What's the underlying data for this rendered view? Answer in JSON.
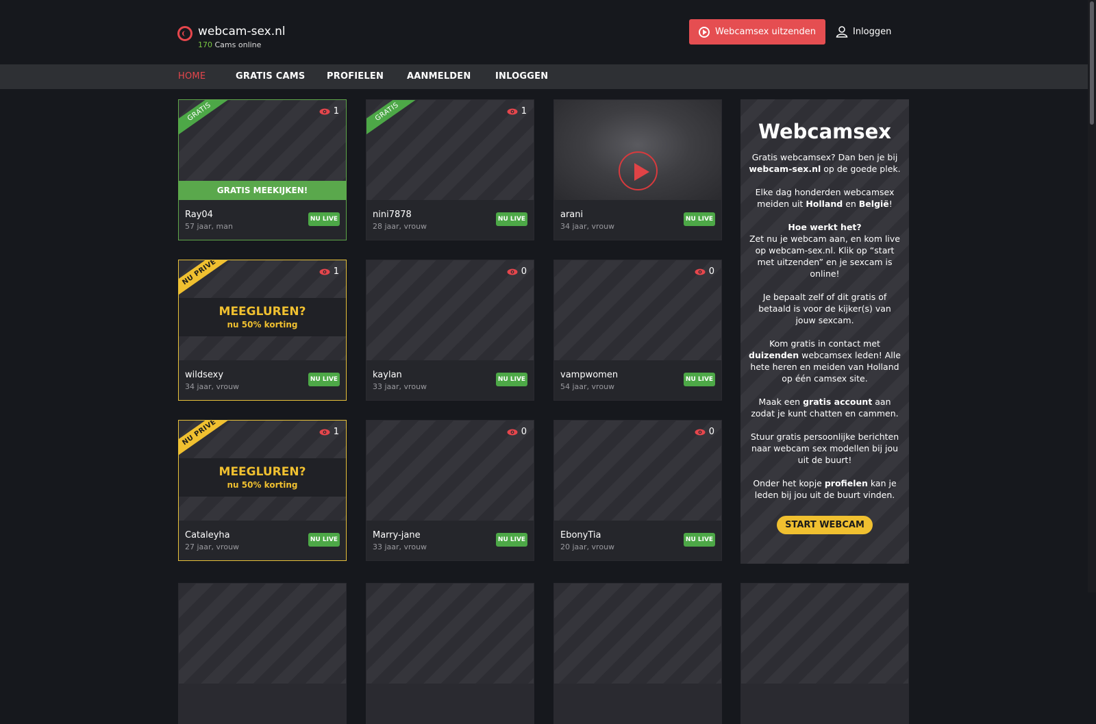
{
  "header": {
    "site_name": "webcam-sex.nl",
    "cams_online_count": "170",
    "cams_online_label": "Cams online",
    "broadcast_label": "Webcamsex uitzenden",
    "login_label": "Inloggen"
  },
  "nav": {
    "items": [
      "HOME",
      "GRATIS CAMS",
      "PROFIELEN",
      "AANMELDEN",
      "INLOGGEN"
    ]
  },
  "cards": [
    {
      "name": "Ray04",
      "meta": "57 jaar, man",
      "viewers": "1",
      "badge": "NU LIVE",
      "ribbon": "GRATIS",
      "banner": "GRATIS MEEKIJKEN!"
    },
    {
      "name": "nini7878",
      "meta": "28 jaar, vrouw",
      "viewers": "1",
      "badge": "NU LIVE",
      "ribbon": "GRATIS"
    },
    {
      "name": "arani",
      "meta": "34 jaar, vrouw",
      "badge": "NU LIVE"
    },
    {
      "name": "wildsexy",
      "meta": "34 jaar, vrouw",
      "viewers": "1",
      "badge": "NU LIVE",
      "ribbon": "NU PRIVE",
      "prive_title": "MEEGLUREN?",
      "prive_sub": "nu 50% korting"
    },
    {
      "name": "kaylan",
      "meta": "33 jaar, vrouw",
      "viewers": "0",
      "badge": "NU LIVE"
    },
    {
      "name": "vampwomen",
      "meta": "54 jaar, vrouw",
      "viewers": "0",
      "badge": "NU LIVE"
    },
    {
      "name": "Cataleyha",
      "meta": "27 jaar, vrouw",
      "viewers": "1",
      "badge": "NU LIVE",
      "ribbon": "NU PRIVE",
      "prive_title": "MEEGLUREN?",
      "prive_sub": "nu 50% korting"
    },
    {
      "name": "Marry-jane",
      "meta": "33 jaar, vrouw",
      "viewers": "0",
      "badge": "NU LIVE"
    },
    {
      "name": "EbonyTia",
      "meta": "20 jaar, vrouw",
      "viewers": "0",
      "badge": "NU LIVE"
    }
  ],
  "sidebar": {
    "title": "Webcamsex",
    "p1a": "Gratis webcamsex? Dan ben je bij ",
    "p1b": "webcam-sex.nl",
    "p1c": " op de goede plek.",
    "p2a": "Elke dag honderden webcamsex meiden uit ",
    "p2b": "Holland",
    "p2c": " en ",
    "p2d": "België",
    "p2e": "!",
    "p3_title": "Hoe werkt het?",
    "p3_text": "Zet nu je webcam aan, en kom live op webcam-sex.nl. Klik op “start met uitzenden” en je sexcam is online!",
    "p4": "Je bepaalt zelf of dit gratis of betaald is voor de kijker(s) van jouw sexcam.",
    "p5a": "Kom gratis in contact met ",
    "p5b": "duizenden",
    "p5c": " webcamsex leden! Alle hete heren en meiden van Holland op één camsex site.",
    "p6a": "Maak een ",
    "p6b": "gratis account",
    "p6c": " aan zodat je kunt chatten en cammen.",
    "p7": "Stuur gratis persoonlijke berichten naar webcam sex modellen bij jou uit de buurt!",
    "p8a": "Onder het kopje ",
    "p8b": "profielen",
    "p8c": " kan je leden bij jou uit de buurt vinden.",
    "button": "START WEBCAM"
  },
  "colors": {
    "accent_red": "#e54e51",
    "live_green": "#4da847",
    "prive_yellow": "#f0c030",
    "background": "#16181d"
  }
}
